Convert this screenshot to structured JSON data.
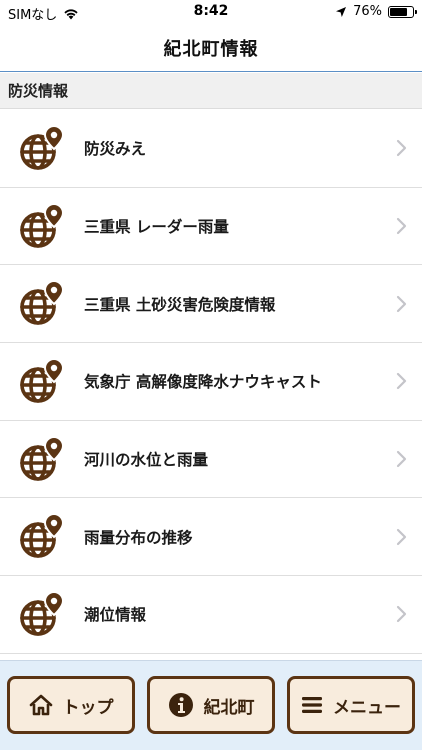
{
  "status": {
    "carrier": "SIMなし",
    "time": "8:42",
    "battery_percent": "76%",
    "battery_level": 0.76
  },
  "nav": {
    "title": "紀北町情報"
  },
  "section": {
    "title": "防災情報"
  },
  "items": [
    {
      "label": "防災みえ"
    },
    {
      "label": "三重県 レーダー雨量"
    },
    {
      "label": "三重県 土砂災害危険度情報"
    },
    {
      "label": "気象庁 高解像度降水ナウキャスト"
    },
    {
      "label": "河川の水位と雨量"
    },
    {
      "label": "雨量分布の推移"
    },
    {
      "label": "潮位情報"
    }
  ],
  "tabs": {
    "top": "トップ",
    "town": "紀北町",
    "menu": "メニュー"
  },
  "colors": {
    "brown": "#5b3413",
    "nav_border": "#5c8fc6",
    "tab_bg": "#e2eef9",
    "button_bg": "#f8ecdd"
  },
  "icons": {
    "item_icon": "globe-pin-icon",
    "chevron": "chevron-right-icon",
    "top": "home-icon",
    "town": "info-icon",
    "menu": "hamburger-icon"
  }
}
